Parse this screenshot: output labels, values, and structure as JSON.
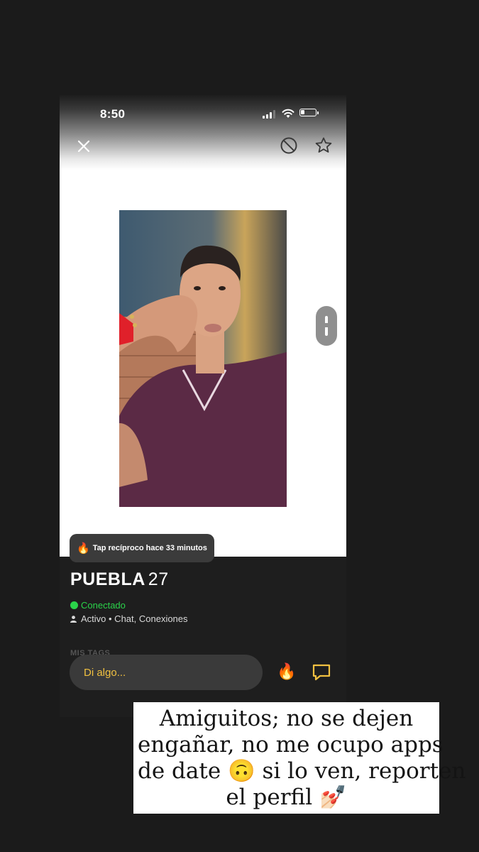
{
  "status_bar": {
    "time": "8:50"
  },
  "profile": {
    "tap_badge": {
      "icon": "🔥",
      "text": "Tap recíproco hace 33 minutos"
    },
    "name": "PUEBLA",
    "age": "27",
    "status": "Conectado",
    "activity": "Activo • Chat, Conexiones",
    "tags_label": "MIS TAGS"
  },
  "chat": {
    "placeholder": "Di algo...",
    "fire_icon": "🔥"
  },
  "caption": {
    "lines": [
      "Amiguitos; no se dejen",
      "engañar, no me ocupo apps",
      "de date 🙃 si lo ven, reporten",
      "el perfil 💅🏻"
    ]
  },
  "colors": {
    "online_green": "#2ad34a",
    "input_text": "#f0c040",
    "background": "#1b1b1b"
  }
}
